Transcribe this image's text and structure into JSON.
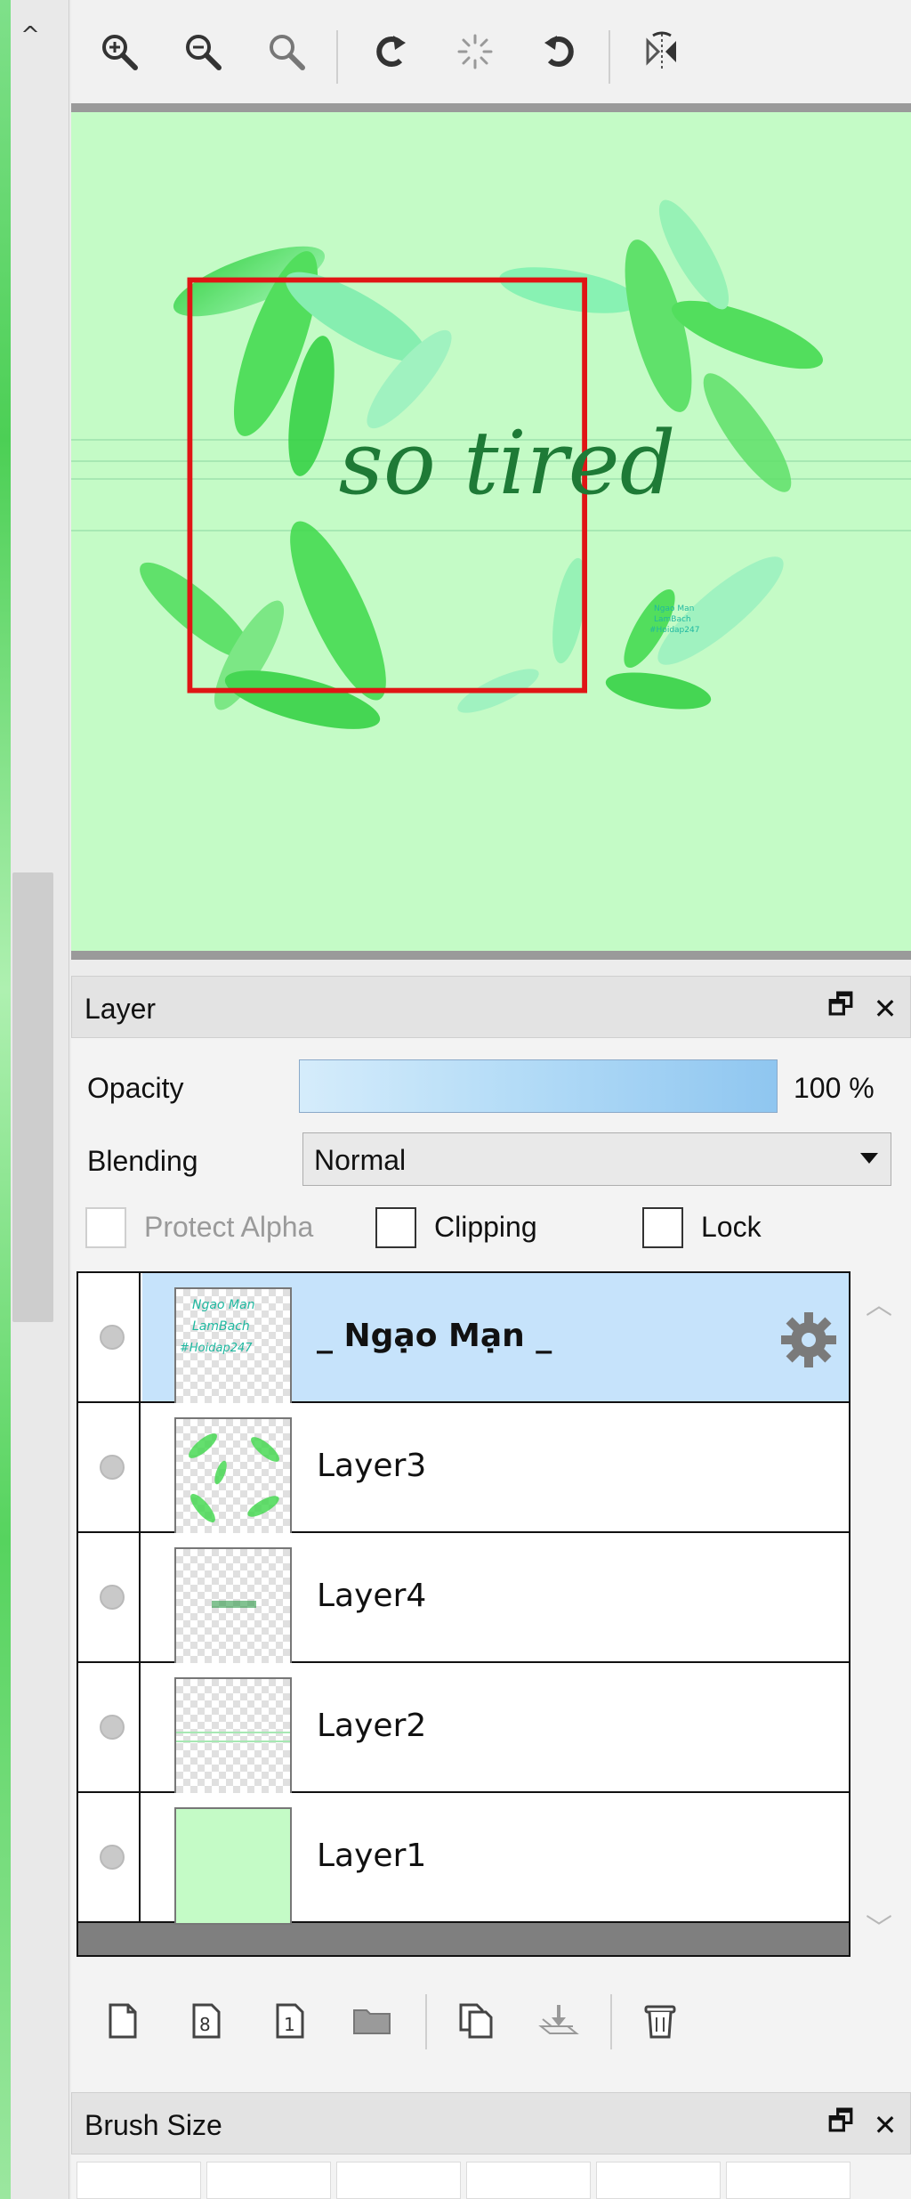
{
  "left_rail": {
    "collapse_glyph": "^"
  },
  "toolbar": {
    "items": [
      "zoom-in-icon",
      "zoom-out-icon",
      "zoom-reset-icon",
      "rotate-left-icon",
      "rotate-reset-icon",
      "rotate-right-icon",
      "flip-horizontal-icon"
    ]
  },
  "canvas": {
    "artwork_text": "so tired",
    "watermark_lines": [
      "Ngao Man",
      "LamBach",
      "#Hoidap247"
    ],
    "selection_color": "#e01515",
    "background_color": "#c4fbc6"
  },
  "layer_panel": {
    "title": "Layer",
    "float_glyph": "🗗",
    "close_glyph": "✕",
    "opacity_label": "Opacity",
    "opacity_value": "100 %",
    "opacity_percent": 100,
    "blending_label": "Blending",
    "blending_value": "Normal",
    "protect_alpha_label": "Protect Alpha",
    "protect_alpha_checked": false,
    "protect_alpha_enabled": false,
    "clipping_label": "Clipping",
    "clipping_checked": false,
    "lock_label": "Lock",
    "lock_checked": false,
    "layers": [
      {
        "name": "_ Ngạo Mạn _",
        "selected": true,
        "has_settings": true,
        "thumb": "text"
      },
      {
        "name": "Layer3",
        "selected": false,
        "thumb": "feathers"
      },
      {
        "name": "Layer4",
        "selected": false,
        "thumb": "small-text"
      },
      {
        "name": "Layer2",
        "selected": false,
        "thumb": "lines"
      },
      {
        "name": "Layer1",
        "selected": false,
        "thumb": "solid"
      }
    ],
    "bottom_tools": [
      "new-layer-icon",
      "new-8bit-layer-icon",
      "new-1bit-layer-icon",
      "new-folder-icon",
      "duplicate-layer-icon",
      "merge-down-icon",
      "delete-layer-icon"
    ]
  },
  "brush_panel": {
    "title": "Brush Size",
    "float_glyph": "🗗",
    "close_glyph": "✕"
  }
}
